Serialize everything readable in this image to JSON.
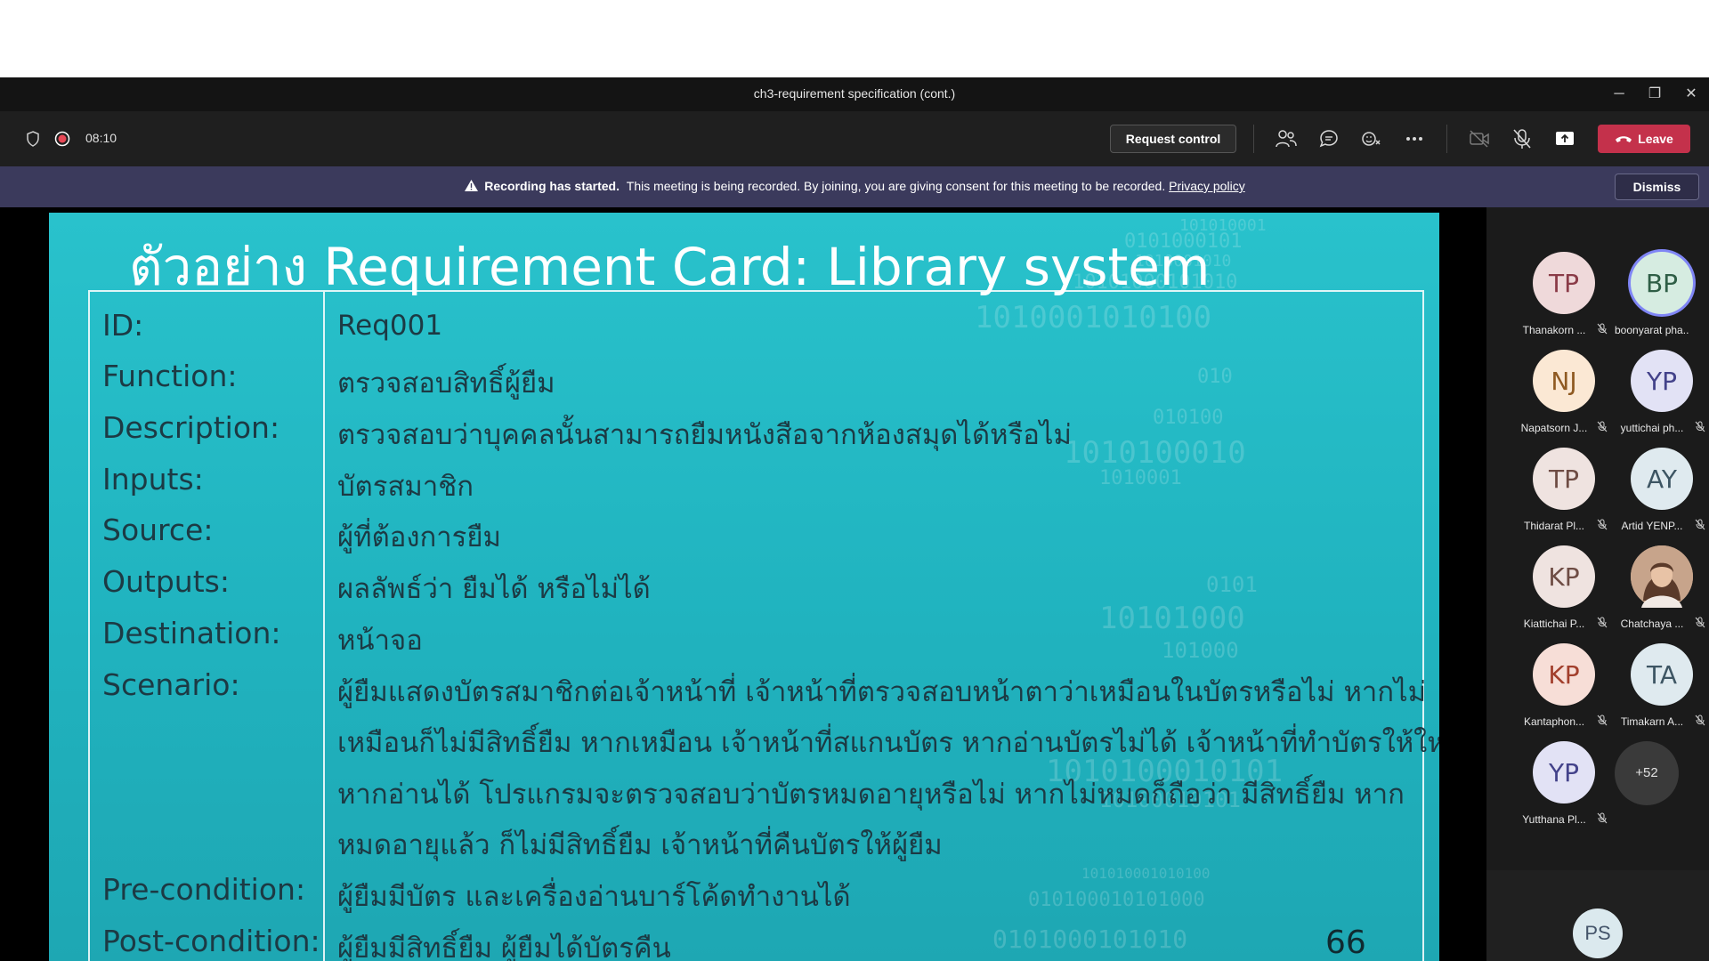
{
  "window": {
    "title": "ch3-requirement specification (cont.)",
    "minimize_glyph": "─",
    "restore_glyph": "❐",
    "close_glyph": "✕"
  },
  "toolbar": {
    "timer": "08:10",
    "request_control_label": "Request control",
    "leave_label": "Leave",
    "icons": [
      "shield-icon",
      "record-icon",
      "people-icon",
      "chat-icon",
      "reactions-icon",
      "more-icon",
      "camera-off-icon",
      "mic-off-icon",
      "share-icon",
      "phone-icon"
    ],
    "leave_color": "#c4314b"
  },
  "banner": {
    "bold_text": "Recording has started.",
    "text": "This meeting is being recorded. By joining, you are giving consent for this meeting to be recorded.",
    "link_text": "Privacy policy",
    "dismiss_label": "Dismiss"
  },
  "slide": {
    "title": "ตัวอย่าง Requirement Card: Library system",
    "page_number": "66",
    "rows": [
      {
        "label": "ID:",
        "value": "Req001"
      },
      {
        "label": "Function:",
        "value": "ตรวจสอบสิทธิ์ผู้ยืม"
      },
      {
        "label": "Description:",
        "value": "ตรวจสอบว่าบุคคลนั้นสามารถยืมหนังสือจากห้องสมุดได้หรือไม่"
      },
      {
        "label": "Inputs:",
        "value": "บัตรสมาชิก"
      },
      {
        "label": "Source:",
        "value": "ผู้ที่ต้องการยืม"
      },
      {
        "label": "Outputs:",
        "value": "ผลลัพธ์ว่า ยืมได้ หรือไม่ได้"
      },
      {
        "label": "Destination:",
        "value": "หน้าจอ"
      },
      {
        "label": "Scenario:",
        "value": "ผู้ยืมแสดงบัตรสมาชิกต่อเจ้าหน้าที่ เจ้าหน้าที่ตรวจสอบหน้าตาว่าเหมือนในบัตรหรือไม่ หากไม่"
      },
      {
        "label": "",
        "value": "เหมือนก็ไม่มีสิทธิ์ยืม หากเหมือน เจ้าหน้าที่สแกนบัตร หากอ่านบัตรไม่ได้ เจ้าหน้าที่ทำบัตรให้ใหม่"
      },
      {
        "label": "",
        "value": "หากอ่านได้ โปรแกรมจะตรวจสอบว่าบัตรหมดอายุหรือไม่ หากไม่หมดก็ถือว่า มีสิทธิ์ยืม หาก"
      },
      {
        "label": "",
        "value": "หมดอายุแล้ว ก็ไม่มีสิทธิ์ยืม เจ้าหน้าที่คืนบัตรให้ผู้ยืม"
      },
      {
        "label": "Pre-condition:",
        "value": "ผู้ยืมมีบัตร และเครื่องอ่านบาร์โค้ดทำงานได้"
      },
      {
        "label": "Post-condition:",
        "value": "ผู้ยืมมีสิทธิ์ยืม ผู้ยืมได้บัตรคืน"
      }
    ],
    "binary_decor": [
      "101010001",
      "0101000101",
      "1010001010",
      "10101000101010",
      "1010001010100",
      "010",
      "010100",
      "1010100010",
      "1010001",
      "0101",
      "10101000",
      "101000",
      "1010100010101",
      "10100010101",
      "101010001010100",
      "010100010101000",
      "0101000101010"
    ]
  },
  "participants": [
    {
      "initials": "TP",
      "name": "Thanakorn ...",
      "bg": "#efd9da",
      "fg": "#8a3b47",
      "mic_off": true
    },
    {
      "initials": "BP",
      "name": "boonyarat pha...",
      "bg": "#d6ece1",
      "fg": "#2f5e46",
      "mic_off": false
    },
    {
      "initials": "NJ",
      "name": "Napatsorn J...",
      "bg": "#fbe8d4",
      "fg": "#8f5a22",
      "mic_off": true
    },
    {
      "initials": "YP",
      "name": "yutticha​i ph...",
      "bg": "#e2e2f5",
      "fg": "#43428a",
      "mic_off": true
    },
    {
      "initials": "TP",
      "name": "Thidarat Pl...",
      "bg": "#efe3e0",
      "fg": "#6e4c44",
      "mic_off": true
    },
    {
      "initials": "AY",
      "name": "Artid YENP...",
      "bg": "#dfeaef",
      "fg": "#3d5563",
      "mic_off": true
    },
    {
      "initials": "KP",
      "name": "Kiattichai P...",
      "bg": "#efe3e0",
      "fg": "#6e4c44",
      "mic_off": true
    },
    {
      "initials": "",
      "name": "Chatchaya ...",
      "bg": "#c7a48b",
      "fg": "#ffffff",
      "mic_off": true,
      "photo": true
    },
    {
      "initials": "KP",
      "name": "Kantaphon...",
      "bg": "#f7ded7",
      "fg": "#a23f2c",
      "mic_off": true
    },
    {
      "initials": "TA",
      "name": "Timakarn A...",
      "bg": "#dfeaef",
      "fg": "#3d5563",
      "mic_off": true
    },
    {
      "initials": "YP",
      "name": "Yutthana Pl...",
      "bg": "#e2e2f5",
      "fg": "#43428a",
      "mic_off": true
    }
  ],
  "more_participants": "+52",
  "self": {
    "initials": "PS"
  }
}
